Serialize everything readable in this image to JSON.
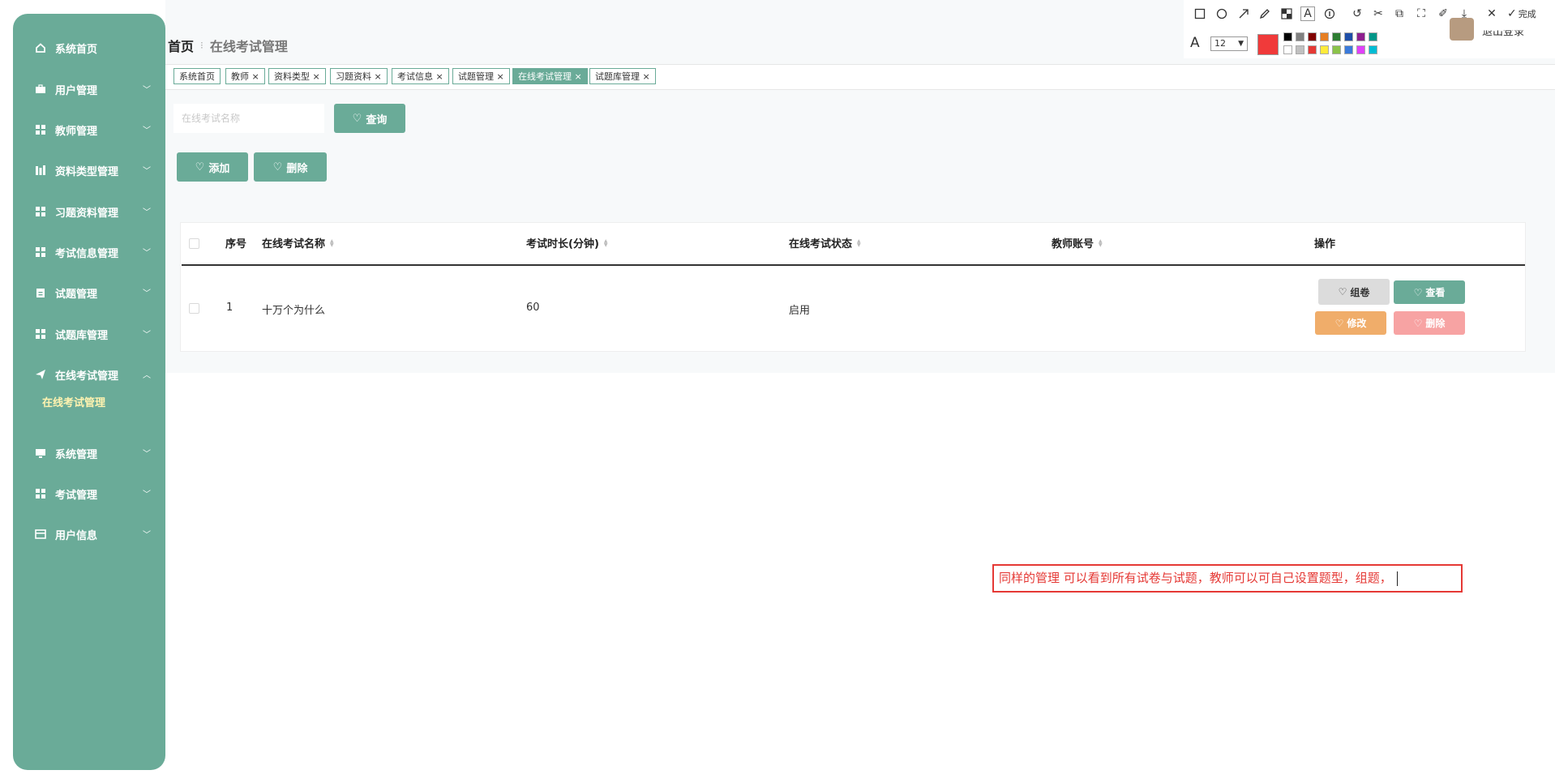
{
  "sidebar": {
    "items": [
      {
        "label": "系统首页",
        "icon": "home-icon"
      },
      {
        "label": "用户管理",
        "icon": "briefcase-icon"
      },
      {
        "label": "教师管理",
        "icon": "grid-icon"
      },
      {
        "label": "资料类型管理",
        "icon": "bars-icon"
      },
      {
        "label": "习题资料管理",
        "icon": "grid-icon"
      },
      {
        "label": "考试信息管理",
        "icon": "grid-icon"
      },
      {
        "label": "试题管理",
        "icon": "clipboard-icon"
      },
      {
        "label": "试题库管理",
        "icon": "grid-icon"
      },
      {
        "label": "在线考试管理",
        "icon": "send-icon"
      },
      {
        "label": "系统管理",
        "icon": "monitor-icon"
      },
      {
        "label": "考试管理",
        "icon": "grid-icon"
      },
      {
        "label": "用户信息",
        "icon": "card-icon"
      }
    ],
    "sub_item": "在线考试管理"
  },
  "breadcrumb": {
    "home": "首页",
    "current": "在线考试管理"
  },
  "tags": [
    "系统首页",
    "教师",
    "资料类型",
    "习题资料",
    "考试信息",
    "试题管理",
    "在线考试管理",
    "试题库管理"
  ],
  "search": {
    "placeholder": "在线考试名称",
    "button": "查询"
  },
  "actions": {
    "add": "添加",
    "delete": "删除"
  },
  "table": {
    "headers": [
      "序号",
      "在线考试名称",
      "考试时长(分钟)",
      "在线考试状态",
      "教师账号",
      "操作"
    ],
    "rows": [
      {
        "index": "1",
        "name": "十万个为什么",
        "duration": "60",
        "status": "启用",
        "teacher": ""
      }
    ],
    "row_actions": [
      "组卷",
      "查看",
      "修改",
      "删除"
    ]
  },
  "toolbar": {
    "done_label": "完成",
    "font_size": "12",
    "current_color": "#f03a3a",
    "colors_top": [
      "#000000",
      "#808080",
      "#800000",
      "#e67e22",
      "#2e7d32",
      "#1f4fa8",
      "#8e1f8e",
      "#009688"
    ],
    "colors_bottom": [
      "#ffffff",
      "#c0c0c0",
      "#e53935",
      "#ffeb3b",
      "#8bc34a",
      "#3b7bdb",
      "#e040fb",
      "#00bcd4"
    ]
  },
  "header": {
    "user_partial": "退出登录"
  },
  "annotation": {
    "text": "同样的管理 可以看到所有试卷与试题，教师可以可自己设置题型，组题，"
  }
}
